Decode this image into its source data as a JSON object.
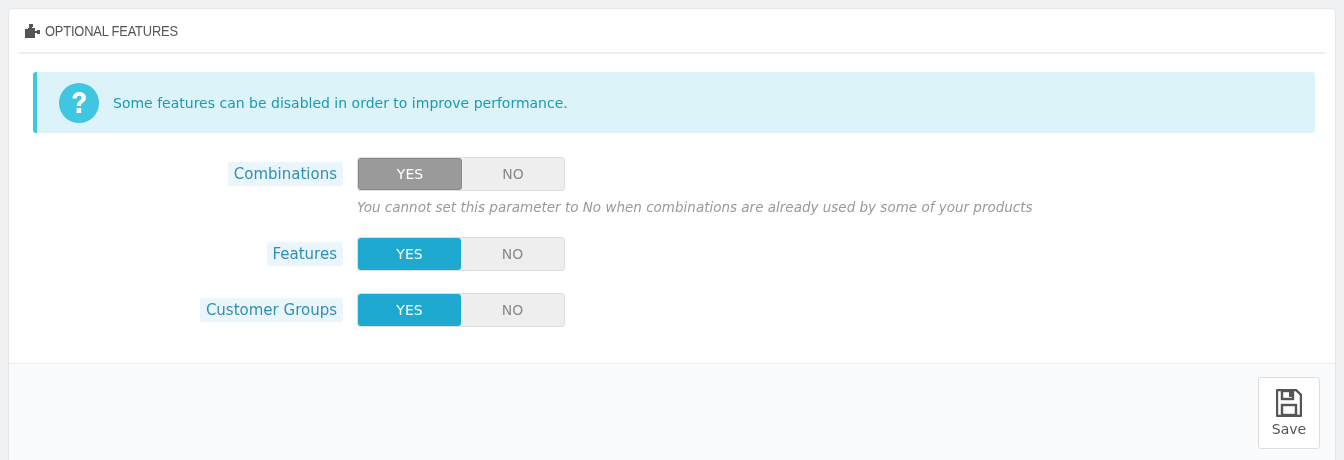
{
  "panel": {
    "title": "OPTIONAL FEATURES"
  },
  "alert": {
    "text": "Some features can be disabled in order to improve performance."
  },
  "fields": [
    {
      "label": "Combinations",
      "disabled": true,
      "options": [
        {
          "label": "YES",
          "selected": true
        },
        {
          "label": "NO",
          "selected": false
        }
      ],
      "help": "You cannot set this parameter to No when combinations are already used by some of your products"
    },
    {
      "label": "Features",
      "disabled": false,
      "options": [
        {
          "label": "YES",
          "selected": true
        },
        {
          "label": "NO",
          "selected": false
        }
      ]
    },
    {
      "label": "Customer Groups",
      "disabled": false,
      "options": [
        {
          "label": "YES",
          "selected": true
        },
        {
          "label": "NO",
          "selected": false
        }
      ]
    }
  ],
  "footer": {
    "save_label": "Save"
  }
}
